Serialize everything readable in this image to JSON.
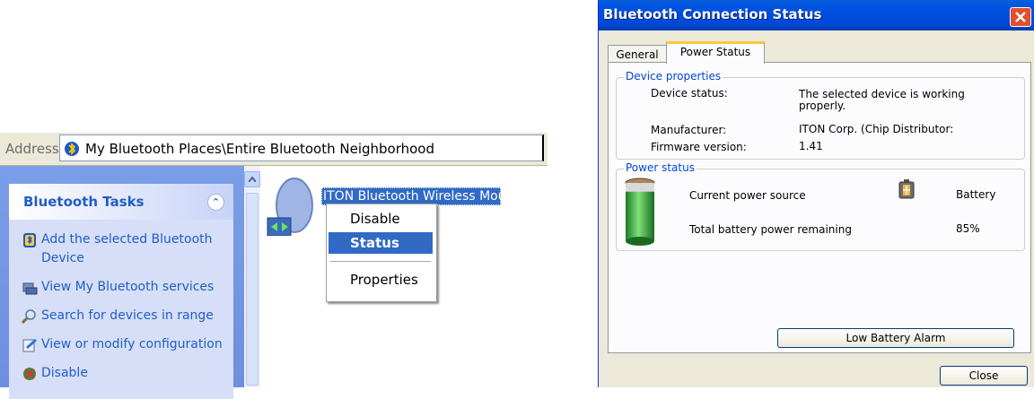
{
  "explorer": {
    "address_label": "Address",
    "address_value": "My Bluetooth Places\\Entire Bluetooth Neighborhood",
    "tasks_title": "Bluetooth Tasks",
    "tasks": [
      {
        "label": "Add the selected Bluetooth Device",
        "icon": "bluetooth-add-icon"
      },
      {
        "label": "View My Bluetooth services",
        "icon": "bluetooth-services-icon"
      },
      {
        "label": "Search for devices in range",
        "icon": "search-icon"
      },
      {
        "label": "View or modify configuration",
        "icon": "configuration-icon"
      },
      {
        "label": "Disable",
        "icon": "disable-icon"
      }
    ],
    "device_label": "ITON Bluetooth Wireless Mouse",
    "context_menu": [
      {
        "label": "Disable",
        "selected": false
      },
      {
        "label": "Status",
        "selected": true
      },
      {
        "label": "Properties",
        "selected": false
      }
    ]
  },
  "dialog": {
    "title": "Bluetooth Connection Status",
    "tabs": [
      {
        "label": "General",
        "active": false
      },
      {
        "label": "Power Status",
        "active": true
      }
    ],
    "device_properties": {
      "title": "Device properties",
      "status_label": "Device status:",
      "status_value": "The selected device is working properly.",
      "manufacturer_label": "Manufacturer:",
      "manufacturer_value": "ITON Corp. (Chip Distributor:",
      "firmware_label": "Firmware version:",
      "firmware_value": "1.41"
    },
    "power_status": {
      "title": "Power status",
      "source_label": "Current power source",
      "source_value": "Battery",
      "remaining_label": "Total battery power remaining",
      "remaining_value": "85%",
      "remaining_fraction": 0.85
    },
    "low_battery_button": "Low Battery Alarm",
    "close_button": "Close"
  },
  "colors": {
    "xp_blue_title": "#0054e3",
    "selection_blue": "#316ac5",
    "dialog_bg": "#ece9d8",
    "task_link": "#215dc6",
    "group_title": "#0046d5",
    "battery_green": "#2fae3a"
  }
}
